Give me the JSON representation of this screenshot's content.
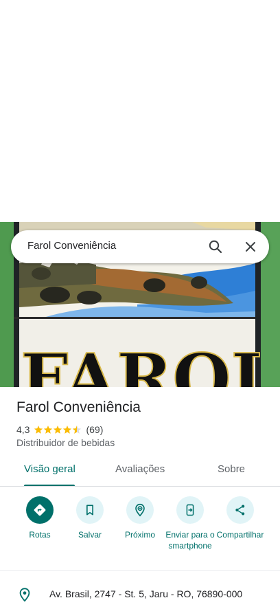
{
  "search": {
    "query": "Farol Conveniência"
  },
  "photo": {
    "sign_text": "FAROL"
  },
  "place": {
    "name": "Farol Conveniência",
    "rating": "4,3",
    "rating_value": 4.3,
    "review_count": "(69)",
    "category": "Distribuidor de bebidas"
  },
  "tabs": [
    {
      "label": "Visão geral",
      "active": true
    },
    {
      "label": "Avaliações",
      "active": false
    },
    {
      "label": "Sobre",
      "active": false
    }
  ],
  "actions": [
    {
      "label": "Rotas",
      "icon": "directions-icon"
    },
    {
      "label": "Salvar",
      "icon": "bookmark-icon"
    },
    {
      "label": "Próximo",
      "icon": "nearby-icon"
    },
    {
      "label": "Enviar para o smartphone",
      "icon": "send-to-phone-icon"
    },
    {
      "label": "Compartilhar",
      "icon": "share-icon"
    }
  ],
  "address": "Av. Brasil, 2747 - St. 5, Jaru - RO, 76890-000",
  "colors": {
    "accent": "#00706a",
    "accent_light": "#e1f4f7",
    "star": "#fbbc04",
    "text_primary": "#202124",
    "text_secondary": "#5f6368"
  }
}
